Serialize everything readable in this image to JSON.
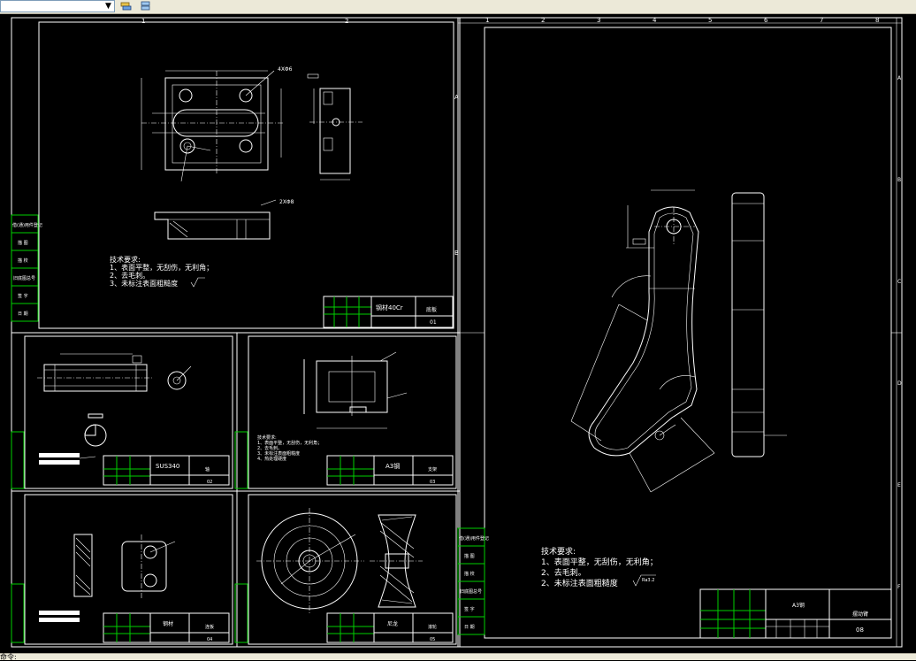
{
  "toolbar": {
    "layer_combo_value": "",
    "icons": [
      "layer-stack-icon",
      "layer-properties-icon"
    ]
  },
  "statusbar": {
    "text": "命令:"
  },
  "left_sheet": {
    "zone_numbers_top": [
      "1",
      "2"
    ],
    "zone_letters_right": [
      "A",
      "B"
    ],
    "side_stamp_labels": [
      "借(通)用件登记",
      "描 图",
      "描 校",
      "旧底图总号",
      "签 字",
      "日 期"
    ],
    "detail_dimension": "4XΦ6",
    "section_dimension": "2XΦ8",
    "tech_requirements": [
      "技术要求:",
      "1、表面平整，无刮伤，无利角；",
      "2、去毛刺。",
      "3、未标注表面粗糙度"
    ],
    "title_block": {
      "material": "钢材40Cr",
      "name": "底板",
      "number": "01"
    }
  },
  "panel_a": {
    "material": "SUS340",
    "name": "轴",
    "number": "02"
  },
  "panel_b": {
    "material": "A3钢",
    "name": "支架",
    "number": "03",
    "tech_requirements": [
      "技术要求:",
      "1、表面平整，无刮伤，无利角；",
      "2、去毛刺。",
      "3、未标注表面粗糙度",
      "4、热处理硬度"
    ]
  },
  "panel_c": {
    "material": "钢材",
    "name": "连板",
    "number": "04"
  },
  "panel_d": {
    "material": "尼龙",
    "name": "滚轮",
    "number": "05"
  },
  "right_sheet": {
    "zone_numbers_top": [
      "1",
      "2",
      "3",
      "4",
      "5",
      "6",
      "7",
      "8"
    ],
    "zone_letters_right": [
      "A",
      "B",
      "C",
      "D",
      "E",
      "F"
    ],
    "side_stamp_labels": [
      "借(通)用件登记",
      "描 图",
      "描 校",
      "旧底图总号",
      "签 字",
      "日 期"
    ],
    "tech_requirements": [
      "技术要求:",
      "1、表面平整，无刮伤，无利角；",
      "2、去毛刺。",
      "2、未标注表面粗糙度"
    ],
    "roughness": "Ra3.2",
    "title_block": {
      "material": "A3钢",
      "name": "摆动臂",
      "number": "08"
    }
  },
  "colors": {
    "background": "#000000",
    "lines": "#ffffff",
    "title_block": "#00d000"
  }
}
